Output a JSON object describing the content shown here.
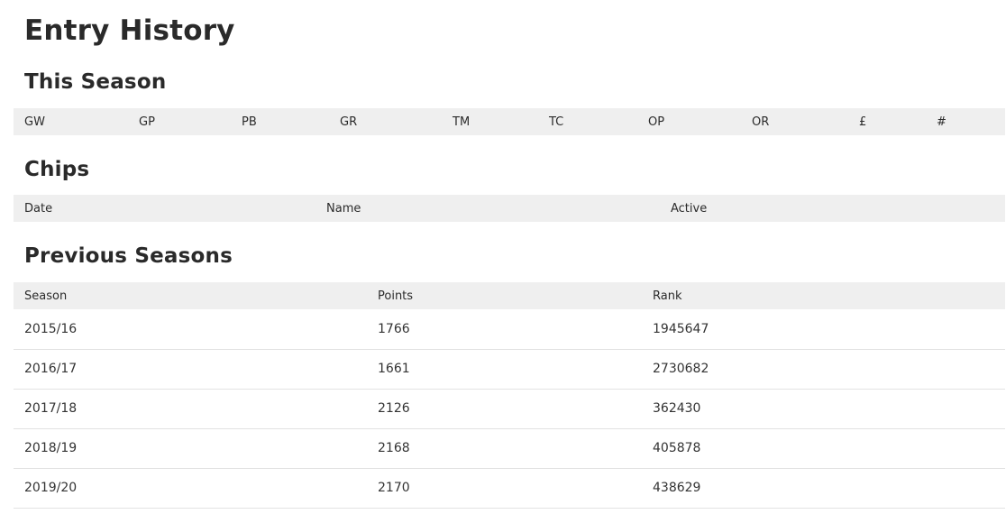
{
  "page": {
    "title": "Entry History"
  },
  "this_season": {
    "heading": "This Season",
    "columns": [
      "GW",
      "GP",
      "PB",
      "GR",
      "TM",
      "TC",
      "OP",
      "OR",
      "£",
      "#"
    ]
  },
  "chips": {
    "heading": "Chips",
    "columns": [
      "Date",
      "Name",
      "Active"
    ]
  },
  "previous_seasons": {
    "heading": "Previous Seasons",
    "columns": [
      "Season",
      "Points",
      "Rank"
    ],
    "rows": [
      [
        "2015/16",
        "1766",
        "1945647"
      ],
      [
        "2016/17",
        "1661",
        "2730682"
      ],
      [
        "2017/18",
        "2126",
        "362430"
      ],
      [
        "2018/19",
        "2168",
        "405878"
      ],
      [
        "2019/20",
        "2170",
        "438629"
      ]
    ]
  }
}
